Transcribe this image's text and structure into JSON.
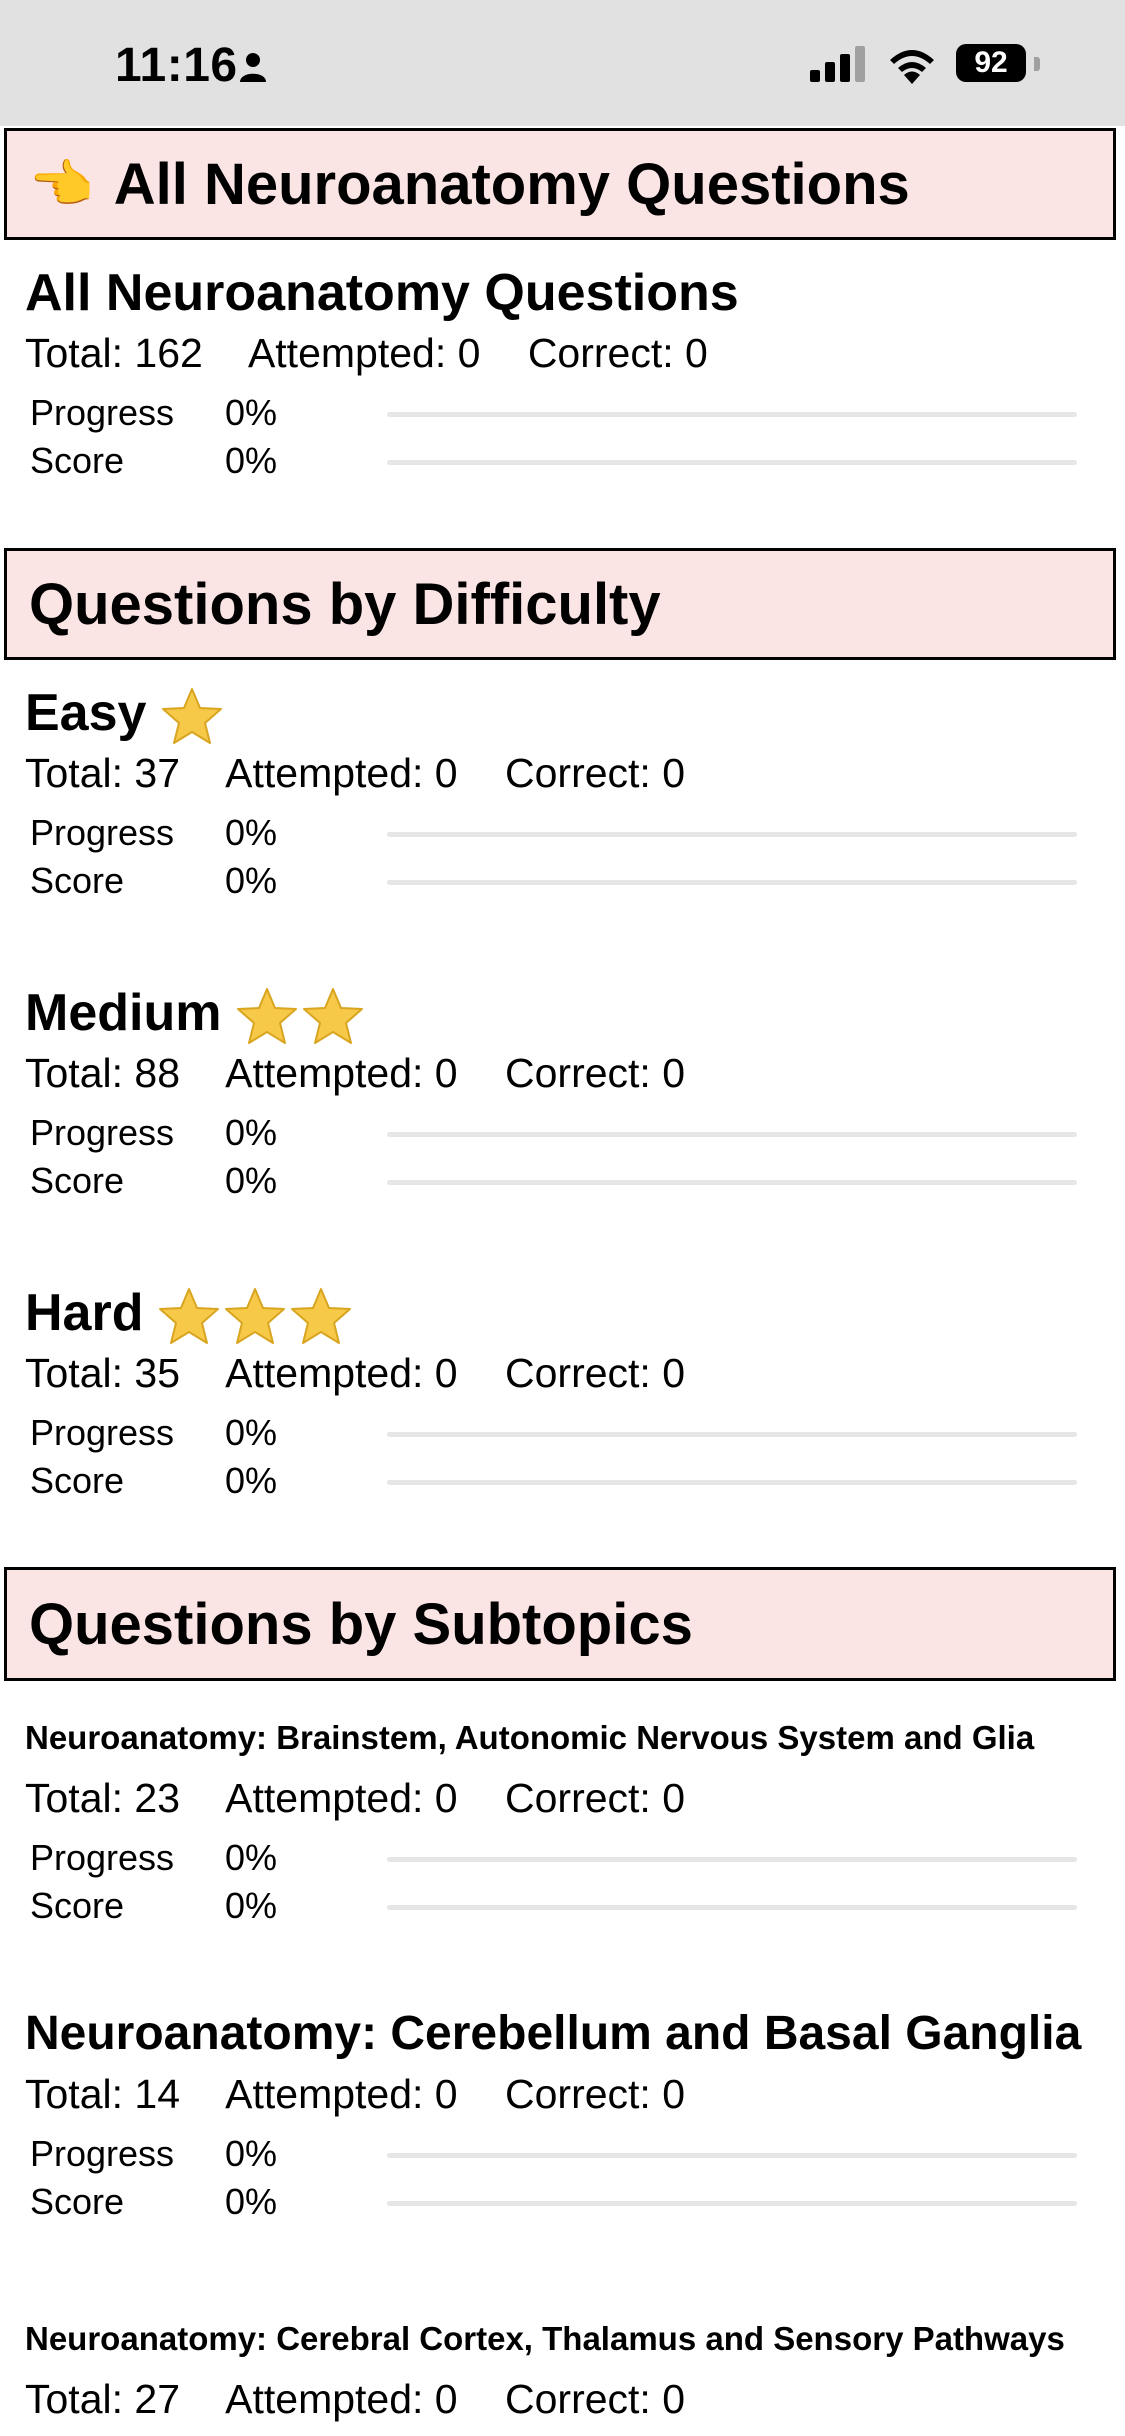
{
  "status_bar": {
    "time": "11:16",
    "battery": "92"
  },
  "overview": {
    "header": "All Neuroanatomy Questions",
    "title": "All Neuroanatomy Questions",
    "total": "Total: 162",
    "attempted": "Attempted: 0",
    "correct": "Correct: 0",
    "progress_label": "Progress",
    "progress_value": "0%",
    "progress_fraction": 0,
    "score_label": "Score",
    "score_value": "0%",
    "score_fraction": 0
  },
  "difficulty": {
    "header": "Questions by Difficulty",
    "items": [
      {
        "title": "Easy",
        "stars": 1,
        "total": "Total: 37",
        "attempted": "Attempted: 0",
        "correct": "Correct: 0",
        "progress_label": "Progress",
        "progress_value": "0%",
        "score_label": "Score",
        "score_value": "0%"
      },
      {
        "title": "Medium",
        "stars": 2,
        "total": "Total: 88",
        "attempted": "Attempted: 0",
        "correct": "Correct: 0",
        "progress_label": "Progress",
        "progress_value": "0%",
        "score_label": "Score",
        "score_value": "0%"
      },
      {
        "title": "Hard",
        "stars": 3,
        "total": "Total: 35",
        "attempted": "Attempted: 0",
        "correct": "Correct: 0",
        "progress_label": "Progress",
        "progress_value": "0%",
        "score_label": "Score",
        "score_value": "0%"
      }
    ]
  },
  "subtopics": {
    "header": "Questions by Subtopics",
    "items": [
      {
        "title": "Neuroanatomy: Brainstem, Autonomic Nervous System and Glia",
        "total": "Total: 23",
        "attempted": "Attempted: 0",
        "correct": "Correct: 0",
        "progress_label": "Progress",
        "progress_value": "0%",
        "score_label": "Score",
        "score_value": "0%"
      },
      {
        "title": "Neuroanatomy: Cerebellum and Basal Ganglia",
        "total": "Total: 14",
        "attempted": "Attempted: 0",
        "correct": "Correct: 0",
        "progress_label": "Progress",
        "progress_value": "0%",
        "score_label": "Score",
        "score_value": "0%"
      },
      {
        "title": "Neuroanatomy: Cerebral Cortex, Thalamus and Sensory Pathways",
        "total": "Total: 27",
        "attempted": "Attempted: 0",
        "correct": "Correct: 0"
      }
    ]
  },
  "colors": {
    "header_bg": "#fbe4e4",
    "bar_track": "#e6e6e6",
    "bar_fill": "#4caf50",
    "star": "#f7c948"
  }
}
